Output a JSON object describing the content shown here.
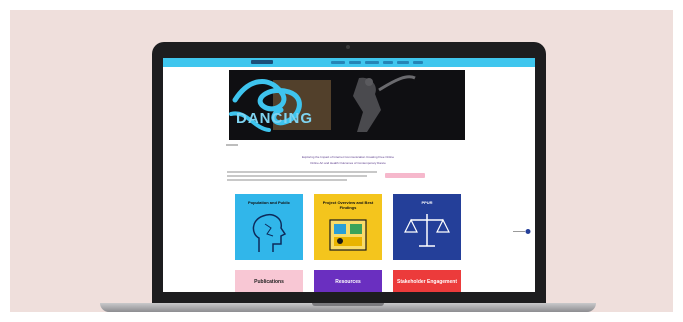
{
  "hero": {
    "title": "DANCING"
  },
  "intro": {
    "line1": "Exploring the Impact of Internet Communication Creating Free Online",
    "line2": "Online Art and Health Outcomes of Contemporary Dance"
  },
  "cards": [
    {
      "label": "Population and Public",
      "color": "#31b6ea"
    },
    {
      "label": "Project Overview and Best Findings",
      "color": "#f4c51d"
    },
    {
      "label": "PPUR",
      "color": "#243f99"
    }
  ],
  "cards_row2": [
    {
      "label": "Publications",
      "color": "#f8c7d4",
      "text_color": "#222222"
    },
    {
      "label": "Resources",
      "color": "#6a2fc0",
      "text_color": "#ffffff"
    },
    {
      "label": "Stakeholder Engagement",
      "color": "#ec3b3b",
      "text_color": "#ffffff"
    }
  ],
  "colors": {
    "background": "#efdfdc",
    "topbar": "#3fc6ee",
    "laptop_bezel": "#1d1d1f"
  }
}
